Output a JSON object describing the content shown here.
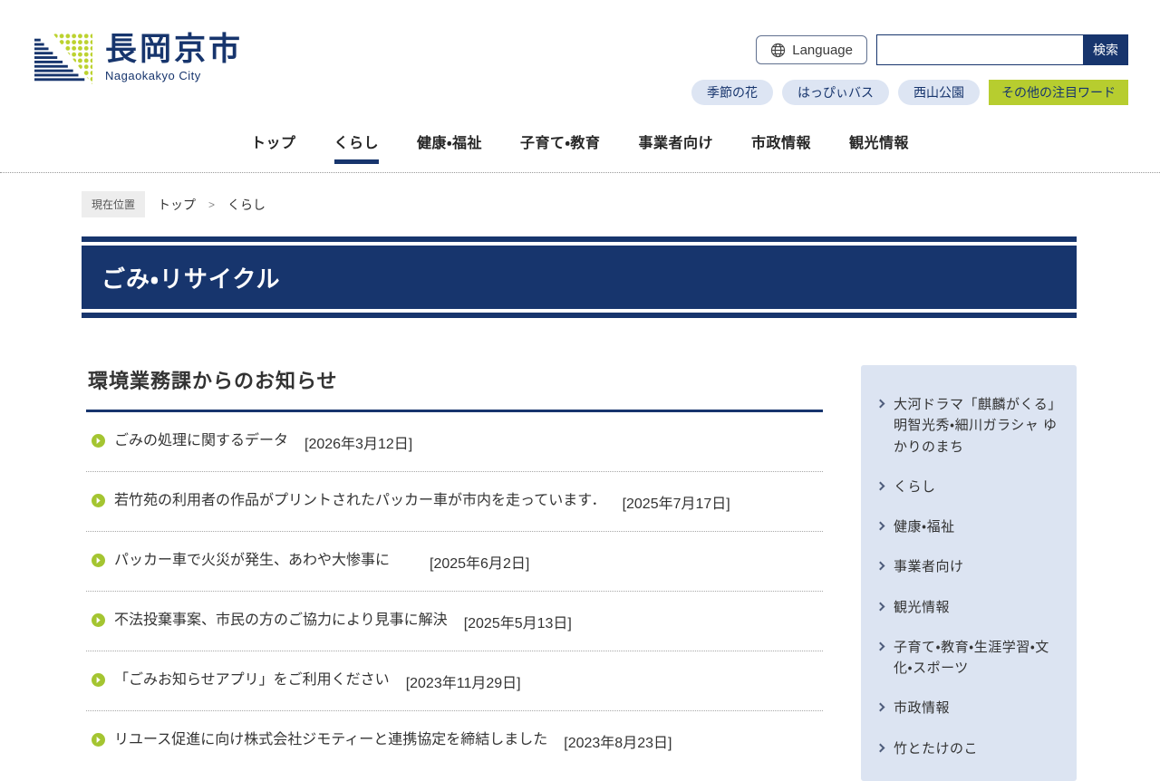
{
  "header": {
    "site_name_jp": "長岡京市",
    "site_name_en": "Nagaokakyo City",
    "language_label": "Language",
    "search": {
      "value": "",
      "placeholder": "",
      "button_label": "検索"
    },
    "tags": [
      {
        "label": "季節の花"
      },
      {
        "label": "はっぴぃバス"
      },
      {
        "label": "西山公園"
      }
    ],
    "featured_tag": "その他の注目ワード"
  },
  "nav": {
    "items": [
      {
        "label": "トップ"
      },
      {
        "label": "くらし"
      },
      {
        "label": "健康・福祉"
      },
      {
        "label": "子育て・教育"
      },
      {
        "label": "事業者向け"
      },
      {
        "label": "市政情報"
      },
      {
        "label": "観光情報"
      }
    ],
    "active_item": "くらし"
  },
  "breadcrumb": {
    "badge": "現在位置",
    "separator": ">",
    "items": [
      "トップ",
      "くらし"
    ]
  },
  "page": {
    "title": "ごみ・リサイクル"
  },
  "main": {
    "section_title": "環境業務課からのお知らせ",
    "news": [
      {
        "title": "ごみの処理に関するデータ",
        "date": "[2026年3月12日]"
      },
      {
        "title": "若竹苑の利用者の作品がプリントされたパッカー車が市内を走っています．",
        "date": "[2025年7月17日]"
      },
      {
        "title": "パッカー車で火災が発生、あわや大惨事に",
        "date": "[2025年6月2日]"
      },
      {
        "title": "不法投棄事案、市民の方のご協力により見事に解決",
        "date": "[2025年5月13日]"
      },
      {
        "title": "「ごみお知らせアプリ」をご利用ください",
        "date": "[2023年11月29日]"
      },
      {
        "title": "リユース促進に向け株式会社ジモティーと連携協定を締結しました",
        "date": "[2023年8月23日]"
      }
    ]
  },
  "sidebar": {
    "items": [
      "大河ドラマ「麒麟がくる」明智光秀・細川ガラシャ ゆかりのまち",
      "くらし",
      "健康・福祉",
      "事業者向け",
      "観光情報",
      "子育て・教育・生涯学習・文化・スポーツ",
      "市政情報",
      "竹とたけのこ"
    ]
  },
  "colors": {
    "navy": "#17356d",
    "lime": "#b7cd2f",
    "pill_bg": "#dde5f3",
    "sidebar_bg": "#dce4f2"
  }
}
